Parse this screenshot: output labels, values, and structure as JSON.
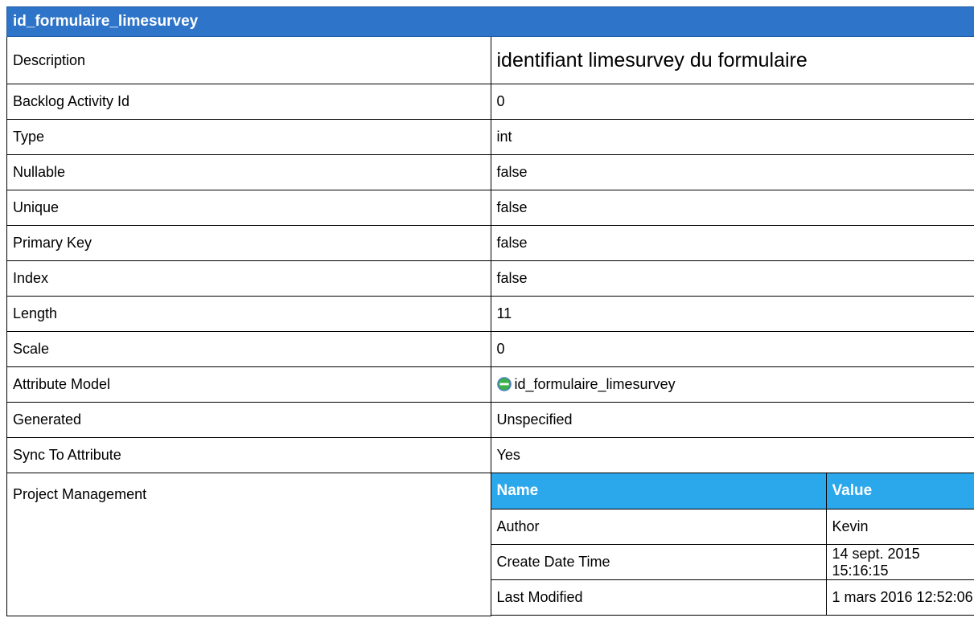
{
  "header": {
    "title": "id_formulaire_limesurvey"
  },
  "rows": [
    {
      "label": "Description",
      "value": "identifiant limesurvey du formulaire"
    },
    {
      "label": "Backlog Activity Id",
      "value": "0"
    },
    {
      "label": "Type",
      "value": "int"
    },
    {
      "label": "Nullable",
      "value": "false"
    },
    {
      "label": "Unique",
      "value": "false"
    },
    {
      "label": "Primary Key",
      "value": "false"
    },
    {
      "label": "Index",
      "value": "false"
    },
    {
      "label": "Length",
      "value": "11"
    },
    {
      "label": "Scale",
      "value": "0"
    },
    {
      "label": "Attribute Model",
      "value": "id_formulaire_limesurvey",
      "icon": "attribute-icon"
    },
    {
      "label": "Generated",
      "value": "Unspecified"
    },
    {
      "label": "Sync To Attribute",
      "value": "Yes"
    }
  ],
  "project_management": {
    "label": "Project Management",
    "columns": [
      "Name",
      "Value"
    ],
    "rows": [
      {
        "name": "Author",
        "value": "Kevin"
      },
      {
        "name": "Create Date Time",
        "value": "14 sept. 2015 15:16:15"
      },
      {
        "name": "Last Modified",
        "value": "1 mars 2016 12:52:06"
      }
    ]
  },
  "colors": {
    "header_bg": "#2e74c8",
    "subheader_bg": "#2ba8ec",
    "icon_fill": "#3cb04a",
    "icon_ring": "#4a7fc1"
  }
}
